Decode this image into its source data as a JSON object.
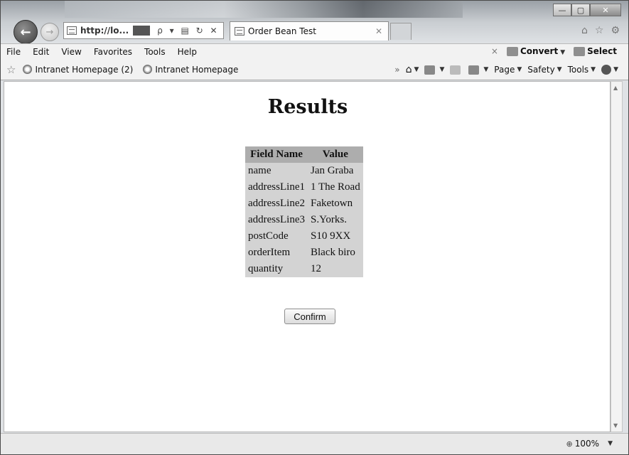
{
  "window": {
    "address_url": "http://lo...",
    "address_tools": "ρ ▾ ▤ ↻ ✕",
    "tab_title": "Order Bean Test",
    "tab_close": "✕",
    "min_glyph": "—",
    "max_glyph": "▢",
    "close_glyph": "✕"
  },
  "menubar": {
    "items": [
      "File",
      "Edit",
      "View",
      "Favorites",
      "Tools",
      "Help"
    ],
    "close_x": "×",
    "convert_label": "Convert",
    "select_label": "Select"
  },
  "favbar": {
    "items": [
      "Intranet Homepage (2)",
      "Intranet Homepage"
    ],
    "overflow": "»",
    "commands": [
      "Page",
      "Safety",
      "Tools"
    ]
  },
  "page": {
    "heading": "Results",
    "table_headers": [
      "Field Name",
      "Value"
    ],
    "rows": [
      [
        "name",
        "Jan Graba"
      ],
      [
        "addressLine1",
        "1 The Road"
      ],
      [
        "addressLine2",
        "Faketown"
      ],
      [
        "addressLine3",
        "S.Yorks."
      ],
      [
        "postCode",
        "S10 9XX"
      ],
      [
        "orderItem",
        "Black biro"
      ],
      [
        "quantity",
        "12"
      ]
    ],
    "confirm_label": "Confirm"
  },
  "statusbar": {
    "zoom_label": "100%"
  },
  "colors": {
    "table_header_bg": "#adadad",
    "table_body_bg": "#d3d3d3"
  }
}
